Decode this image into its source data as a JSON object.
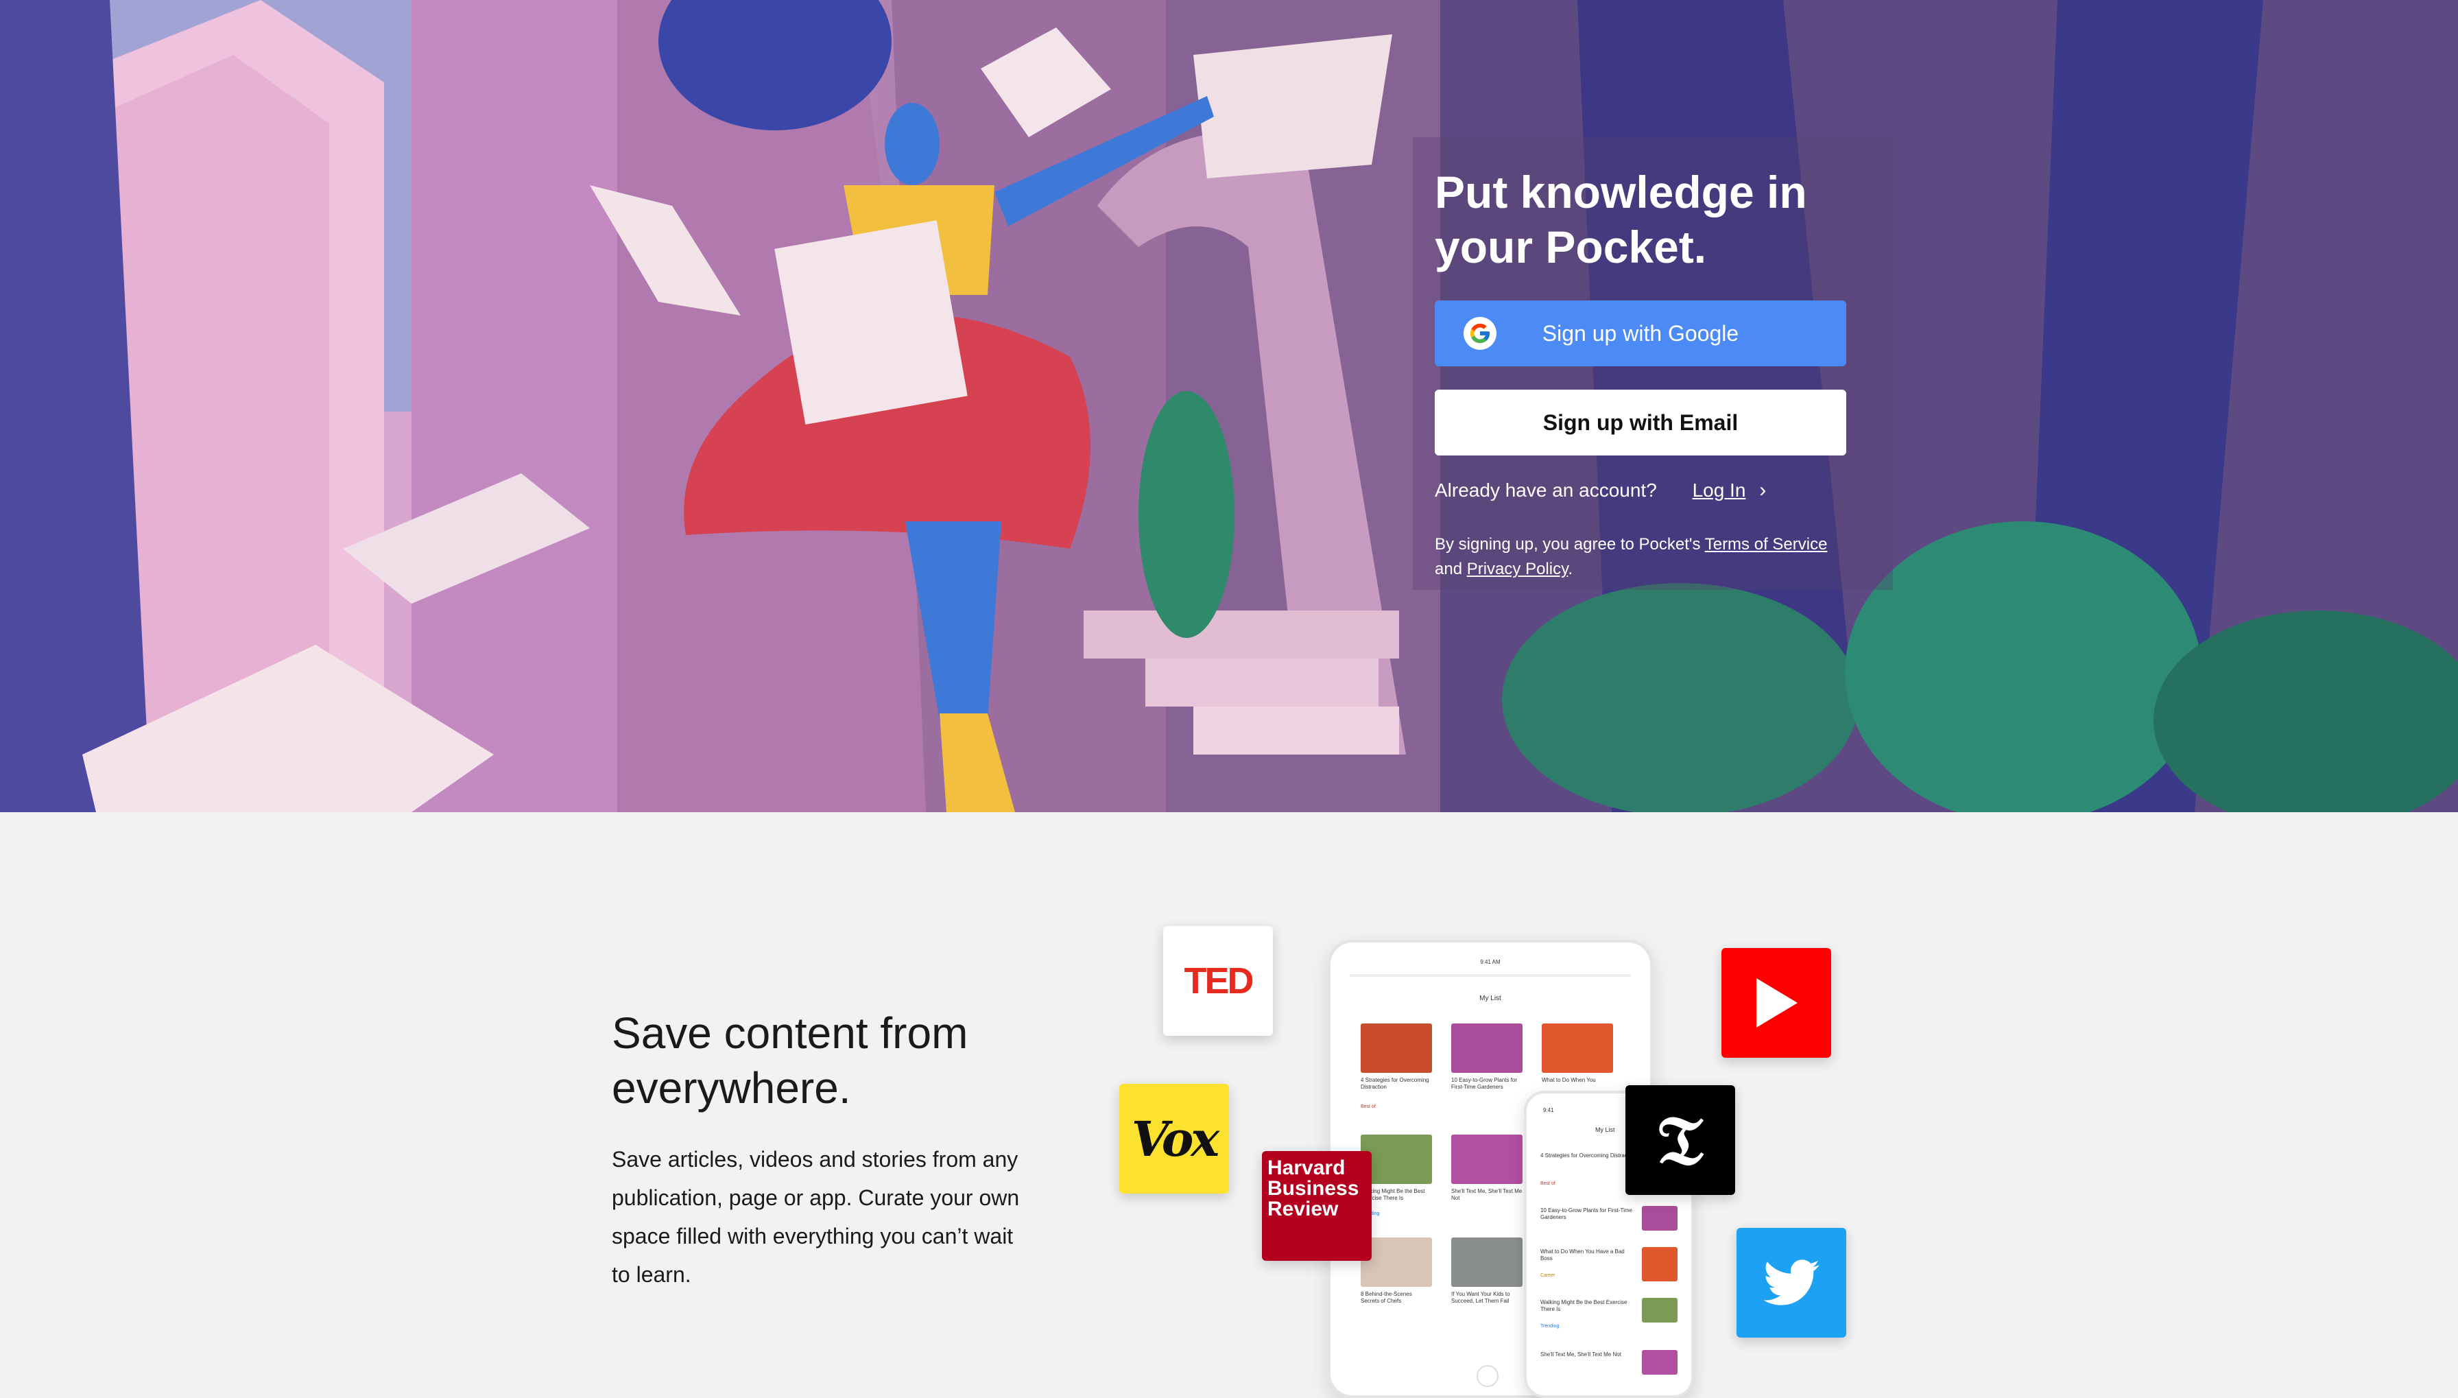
{
  "hero": {
    "headline": "Put knowledge in your Pocket.",
    "google_button": "Sign up with Google",
    "email_button": "Sign up with Email",
    "account_prompt": "Already have an account?",
    "login_link": "Log In",
    "terms_prefix": "By signing up, you agree to Pocket's",
    "terms_link": "Terms of Service",
    "terms_and": "and",
    "privacy_link": "Privacy Policy",
    "terms_end": "."
  },
  "feature": {
    "title": "Save content from everywhere.",
    "body": "Save articles, videos and stories from any publication, page or app. Curate your own space filled with everything you can’t wait to learn."
  },
  "logos": {
    "ted": "TED",
    "vox": "Vox",
    "hbr": "Harvard Business Review"
  },
  "tablet": {
    "status_time": "9:41 AM",
    "title": "My List",
    "items": [
      "4 Strategies for Overcoming Distraction",
      "10 Easy-to-Grow Plants for First-Time Gardeners",
      "What to Do When You",
      "Walking Might Be the Best Exercise There Is",
      "She'll Text Me, She'll Text Me Not",
      "8 Behind-the-Scenes Secrets of Chefs",
      "If You Want Your Kids to Succeed, Let Them Fail"
    ],
    "badges": [
      "Best of",
      "Trending"
    ]
  },
  "phone": {
    "status_time": "9:41",
    "title": "My List",
    "items": [
      "4 Strategies for Overcoming Distraction",
      "10 Easy-to-Grow Plants for First-Time Gardeners",
      "What to Do When You Have a Bad Boss",
      "Walking Might Be the Best Exercise There Is",
      "She'll Text Me, She'll Text Me Not"
    ],
    "badges": [
      "Best of",
      "Career",
      "Trending"
    ]
  },
  "colors": {
    "google_button": "#4c8bf5",
    "vox": "#fce22f",
    "hbr": "#b2001e",
    "youtube": "#ff0000",
    "twitter": "#1da1f2",
    "ted": "#e62b1e"
  },
  "icons": [
    "google-icon",
    "chevron-right-icon",
    "play-icon",
    "twitter-bird-icon",
    "nyt-logo-icon"
  ]
}
